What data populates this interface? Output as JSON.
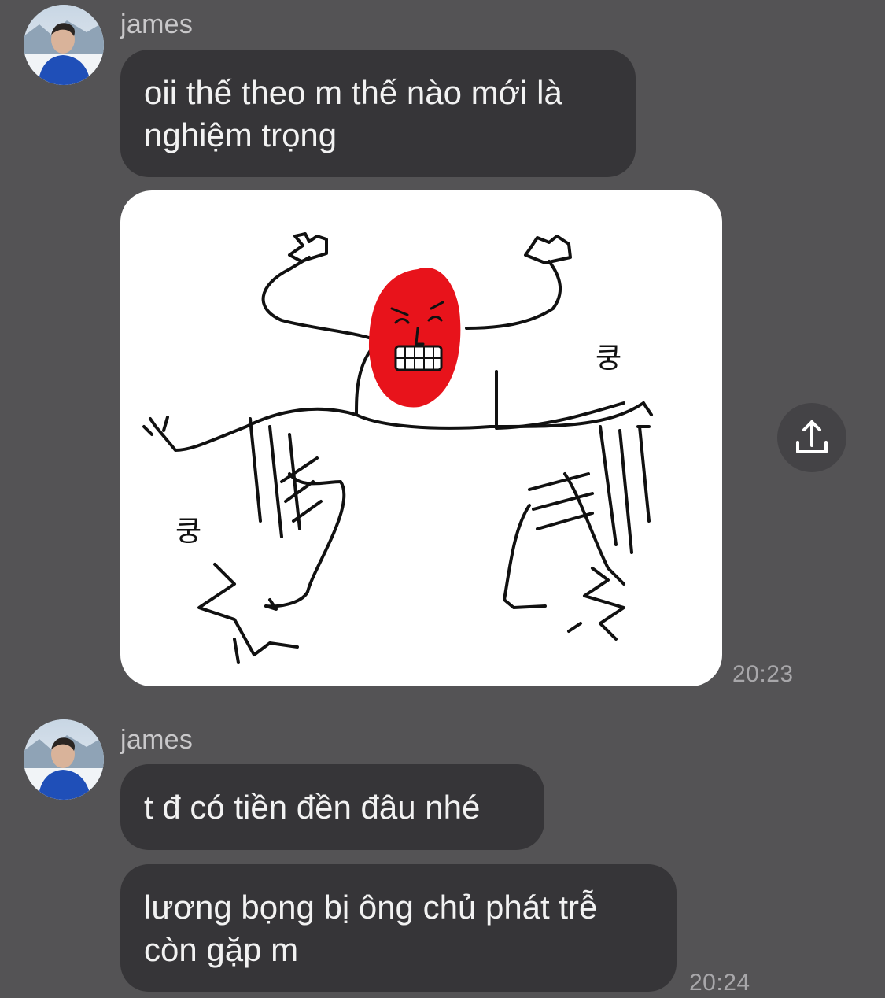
{
  "conversation": {
    "groups": [
      {
        "sender": "james",
        "messages": [
          {
            "lines": [
              "oii thế theo m thế nào mới là",
              "nghiệm trọng"
            ]
          }
        ],
        "image": {
          "caption_glyphs": [
            "쿵",
            "쿵"
          ]
        },
        "time": "20:23"
      },
      {
        "sender": "james",
        "messages": [
          {
            "lines": [
              "t đ có tiền đền đâu nhé"
            ]
          },
          {
            "lines": [
              "lương bọng bị ông chủ phát trễ",
              "còn gặp m"
            ]
          }
        ],
        "time": "20:24"
      }
    ]
  },
  "icons": {
    "avatar": "avatar-photo",
    "share": "share-upload-icon"
  },
  "colors": {
    "background": "#545355",
    "bubble": "#363538",
    "bubble_text": "#f2f2f2",
    "meta_text": "#a8a7aa",
    "sticker_face": "#e8131b"
  }
}
